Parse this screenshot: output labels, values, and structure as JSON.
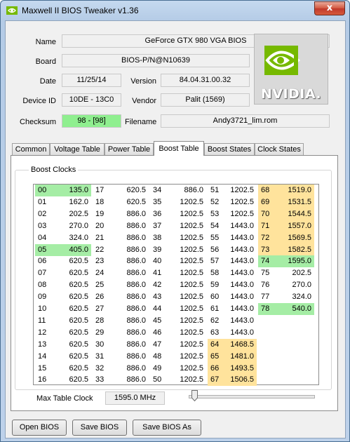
{
  "window": {
    "title": "Maxwell II BIOS Tweaker v1.36",
    "close_glyph": "x"
  },
  "info": {
    "name_label": "Name",
    "name_value": "GeForce GTX 980 VGA BIOS",
    "board_label": "Board",
    "board_value": "BIOS-P/N@N10639",
    "date_label": "Date",
    "date_value": "11/25/14",
    "version_label": "Version",
    "version_value": "84.04.31.00.32",
    "device_label": "Device ID",
    "device_value": "10DE - 13C0",
    "vendor_label": "Vendor",
    "vendor_value": "Palit (1569)",
    "checksum_label": "Checksum",
    "checksum_value": "98 - [98]",
    "filename_label": "Filename",
    "filename_value": "Andy3721_lim.rom",
    "checksum_color": "#8fef8f"
  },
  "logo": {
    "text": "NVIDIA.",
    "icon": "nvidia-eye-logo",
    "brand_color": "#76b900"
  },
  "tabs": [
    {
      "label": "Common",
      "active": false
    },
    {
      "label": "Voltage Table",
      "active": false
    },
    {
      "label": "Power Table",
      "active": false
    },
    {
      "label": "Boost Table",
      "active": true
    },
    {
      "label": "Boost States",
      "active": false
    },
    {
      "label": "Clock States",
      "active": false
    }
  ],
  "boost": {
    "group_title": "Boost Clocks",
    "highlight_colors": {
      "green": "#a5eda5",
      "yellow": "#ffe39c"
    },
    "columns": [
      {
        "rows": [
          {
            "idx": "00",
            "val": "135.0",
            "hl": "green"
          },
          {
            "idx": "01",
            "val": "162.0",
            "hl": ""
          },
          {
            "idx": "02",
            "val": "202.5",
            "hl": ""
          },
          {
            "idx": "03",
            "val": "270.0",
            "hl": ""
          },
          {
            "idx": "04",
            "val": "324.0",
            "hl": ""
          },
          {
            "idx": "05",
            "val": "405.0",
            "hl": "green"
          },
          {
            "idx": "06",
            "val": "620.5",
            "hl": ""
          },
          {
            "idx": "07",
            "val": "620.5",
            "hl": ""
          },
          {
            "idx": "08",
            "val": "620.5",
            "hl": ""
          },
          {
            "idx": "09",
            "val": "620.5",
            "hl": ""
          },
          {
            "idx": "10",
            "val": "620.5",
            "hl": ""
          },
          {
            "idx": "11",
            "val": "620.5",
            "hl": ""
          },
          {
            "idx": "12",
            "val": "620.5",
            "hl": ""
          },
          {
            "idx": "13",
            "val": "620.5",
            "hl": ""
          },
          {
            "idx": "14",
            "val": "620.5",
            "hl": ""
          },
          {
            "idx": "15",
            "val": "620.5",
            "hl": ""
          },
          {
            "idx": "16",
            "val": "620.5",
            "hl": ""
          }
        ]
      },
      {
        "rows": [
          {
            "idx": "17",
            "val": "620.5",
            "hl": ""
          },
          {
            "idx": "18",
            "val": "620.5",
            "hl": ""
          },
          {
            "idx": "19",
            "val": "886.0",
            "hl": ""
          },
          {
            "idx": "20",
            "val": "886.0",
            "hl": ""
          },
          {
            "idx": "21",
            "val": "886.0",
            "hl": ""
          },
          {
            "idx": "22",
            "val": "886.0",
            "hl": ""
          },
          {
            "idx": "23",
            "val": "886.0",
            "hl": ""
          },
          {
            "idx": "24",
            "val": "886.0",
            "hl": ""
          },
          {
            "idx": "25",
            "val": "886.0",
            "hl": ""
          },
          {
            "idx": "26",
            "val": "886.0",
            "hl": ""
          },
          {
            "idx": "27",
            "val": "886.0",
            "hl": ""
          },
          {
            "idx": "28",
            "val": "886.0",
            "hl": ""
          },
          {
            "idx": "29",
            "val": "886.0",
            "hl": ""
          },
          {
            "idx": "30",
            "val": "886.0",
            "hl": ""
          },
          {
            "idx": "31",
            "val": "886.0",
            "hl": ""
          },
          {
            "idx": "32",
            "val": "886.0",
            "hl": ""
          },
          {
            "idx": "33",
            "val": "886.0",
            "hl": ""
          }
        ]
      },
      {
        "rows": [
          {
            "idx": "34",
            "val": "886.0",
            "hl": ""
          },
          {
            "idx": "35",
            "val": "1202.5",
            "hl": ""
          },
          {
            "idx": "36",
            "val": "1202.5",
            "hl": ""
          },
          {
            "idx": "37",
            "val": "1202.5",
            "hl": ""
          },
          {
            "idx": "38",
            "val": "1202.5",
            "hl": ""
          },
          {
            "idx": "39",
            "val": "1202.5",
            "hl": ""
          },
          {
            "idx": "40",
            "val": "1202.5",
            "hl": ""
          },
          {
            "idx": "41",
            "val": "1202.5",
            "hl": ""
          },
          {
            "idx": "42",
            "val": "1202.5",
            "hl": ""
          },
          {
            "idx": "43",
            "val": "1202.5",
            "hl": ""
          },
          {
            "idx": "44",
            "val": "1202.5",
            "hl": ""
          },
          {
            "idx": "45",
            "val": "1202.5",
            "hl": ""
          },
          {
            "idx": "46",
            "val": "1202.5",
            "hl": ""
          },
          {
            "idx": "47",
            "val": "1202.5",
            "hl": ""
          },
          {
            "idx": "48",
            "val": "1202.5",
            "hl": ""
          },
          {
            "idx": "49",
            "val": "1202.5",
            "hl": ""
          },
          {
            "idx": "50",
            "val": "1202.5",
            "hl": ""
          }
        ]
      },
      {
        "rows": [
          {
            "idx": "51",
            "val": "1202.5",
            "hl": ""
          },
          {
            "idx": "52",
            "val": "1202.5",
            "hl": ""
          },
          {
            "idx": "53",
            "val": "1202.5",
            "hl": ""
          },
          {
            "idx": "54",
            "val": "1443.0",
            "hl": ""
          },
          {
            "idx": "55",
            "val": "1443.0",
            "hl": ""
          },
          {
            "idx": "56",
            "val": "1443.0",
            "hl": ""
          },
          {
            "idx": "57",
            "val": "1443.0",
            "hl": ""
          },
          {
            "idx": "58",
            "val": "1443.0",
            "hl": ""
          },
          {
            "idx": "59",
            "val": "1443.0",
            "hl": ""
          },
          {
            "idx": "60",
            "val": "1443.0",
            "hl": ""
          },
          {
            "idx": "61",
            "val": "1443.0",
            "hl": ""
          },
          {
            "idx": "62",
            "val": "1443.0",
            "hl": ""
          },
          {
            "idx": "63",
            "val": "1443.0",
            "hl": ""
          },
          {
            "idx": "64",
            "val": "1468.5",
            "hl": "yellow"
          },
          {
            "idx": "65",
            "val": "1481.0",
            "hl": "yellow"
          },
          {
            "idx": "66",
            "val": "1493.5",
            "hl": "yellow"
          },
          {
            "idx": "67",
            "val": "1506.5",
            "hl": "yellow"
          }
        ]
      },
      {
        "rows": [
          {
            "idx": "68",
            "val": "1519.0",
            "hl": "yellow"
          },
          {
            "idx": "69",
            "val": "1531.5",
            "hl": "yellow"
          },
          {
            "idx": "70",
            "val": "1544.5",
            "hl": "yellow"
          },
          {
            "idx": "71",
            "val": "1557.0",
            "hl": "yellow"
          },
          {
            "idx": "72",
            "val": "1569.5",
            "hl": "yellow"
          },
          {
            "idx": "73",
            "val": "1582.5",
            "hl": "yellow"
          },
          {
            "idx": "74",
            "val": "1595.0",
            "hl": "green"
          },
          {
            "idx": "75",
            "val": "202.5",
            "hl": ""
          },
          {
            "idx": "76",
            "val": "270.0",
            "hl": ""
          },
          {
            "idx": "77",
            "val": "324.0",
            "hl": ""
          },
          {
            "idx": "78",
            "val": "540.0",
            "hl": "green"
          }
        ]
      }
    ],
    "max_label": "Max Table Clock",
    "max_value": "1595.0 MHz"
  },
  "buttons": {
    "open": "Open BIOS",
    "save": "Save BIOS",
    "save_as": "Save BIOS As"
  }
}
